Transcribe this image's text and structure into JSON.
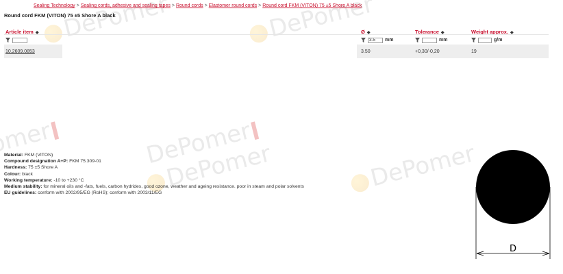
{
  "breadcrumb": [
    "Sealing Technology",
    "Sealing cords, adhesive and sealing tapes",
    "Round cords",
    "Elastomer round cords",
    "Round cord FKM (VITON) 75 ±5 Shore A black"
  ],
  "breadcrumb_separator": ">",
  "page_title": "Round cord FKM (VITON) 75 ±5 Shore A black",
  "table": {
    "headers": {
      "article": "Article item",
      "diameter": "Ø",
      "tolerance": "Tolerance",
      "weight": "Weight approx."
    },
    "sort_icon": "sort-arrows-icon",
    "filters": {
      "article_value": "",
      "diameter_value": "3.5",
      "diameter_unit": "mm",
      "tolerance_value": "",
      "tolerance_unit": "mm",
      "weight_value": "",
      "weight_unit": "g/m"
    },
    "rows": [
      {
        "article": "10.2609.0853",
        "diameter": "3.50",
        "tolerance": "+0,30/-0,20",
        "weight": "19"
      }
    ]
  },
  "description": {
    "material_label": "Material:",
    "material_value": "FKM (VITON)",
    "compound_label": "Compound designation A+P:",
    "compound_value": "FKM 75.309-01",
    "hardness_label": "Hardness:",
    "hardness_value": "75 ±5 Shore A",
    "colour_label": "Colour:",
    "colour_value": "black",
    "temp_label": "Working temperature:",
    "temp_value": "-10 to +230 °C",
    "stability_label": "Medium stability:",
    "stability_value": "for mineral oils and -fats, fuels, carbon hydrides, good ozone, weather and ageing resistance. poor in steam and polar solvents",
    "eu_label": "EU guidelines:",
    "eu_value": "conform with 2002/95/EG (RoHS); conform with 2003/11/EG"
  },
  "diagram": {
    "dimension_label": "D"
  },
  "watermark_text": "DePomer",
  "colors": {
    "link_red": "#c8102e",
    "row_grey": "#eeeeee"
  }
}
